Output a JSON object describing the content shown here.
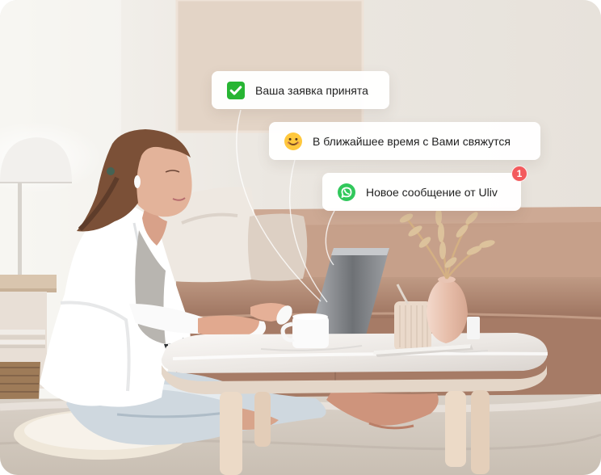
{
  "notifications": [
    {
      "icon": "green-checkmark-icon",
      "text": "Ваша заявка принята"
    },
    {
      "icon": "smiling-face-icon",
      "text": "В ближайшее время с Вами свяжутся"
    },
    {
      "icon": "whatsapp-icon",
      "text": "Новое сообщение от Uliv",
      "badge": "1"
    }
  ],
  "colors": {
    "check_green": "#27b533",
    "whatsapp_green": "#31c85b",
    "badge_red": "#f35a5d",
    "toast_text": "#1f1f1f",
    "sofa_brown": "#b38a72",
    "marble_table": "#eeebe8",
    "wall": "#ece8e2"
  }
}
